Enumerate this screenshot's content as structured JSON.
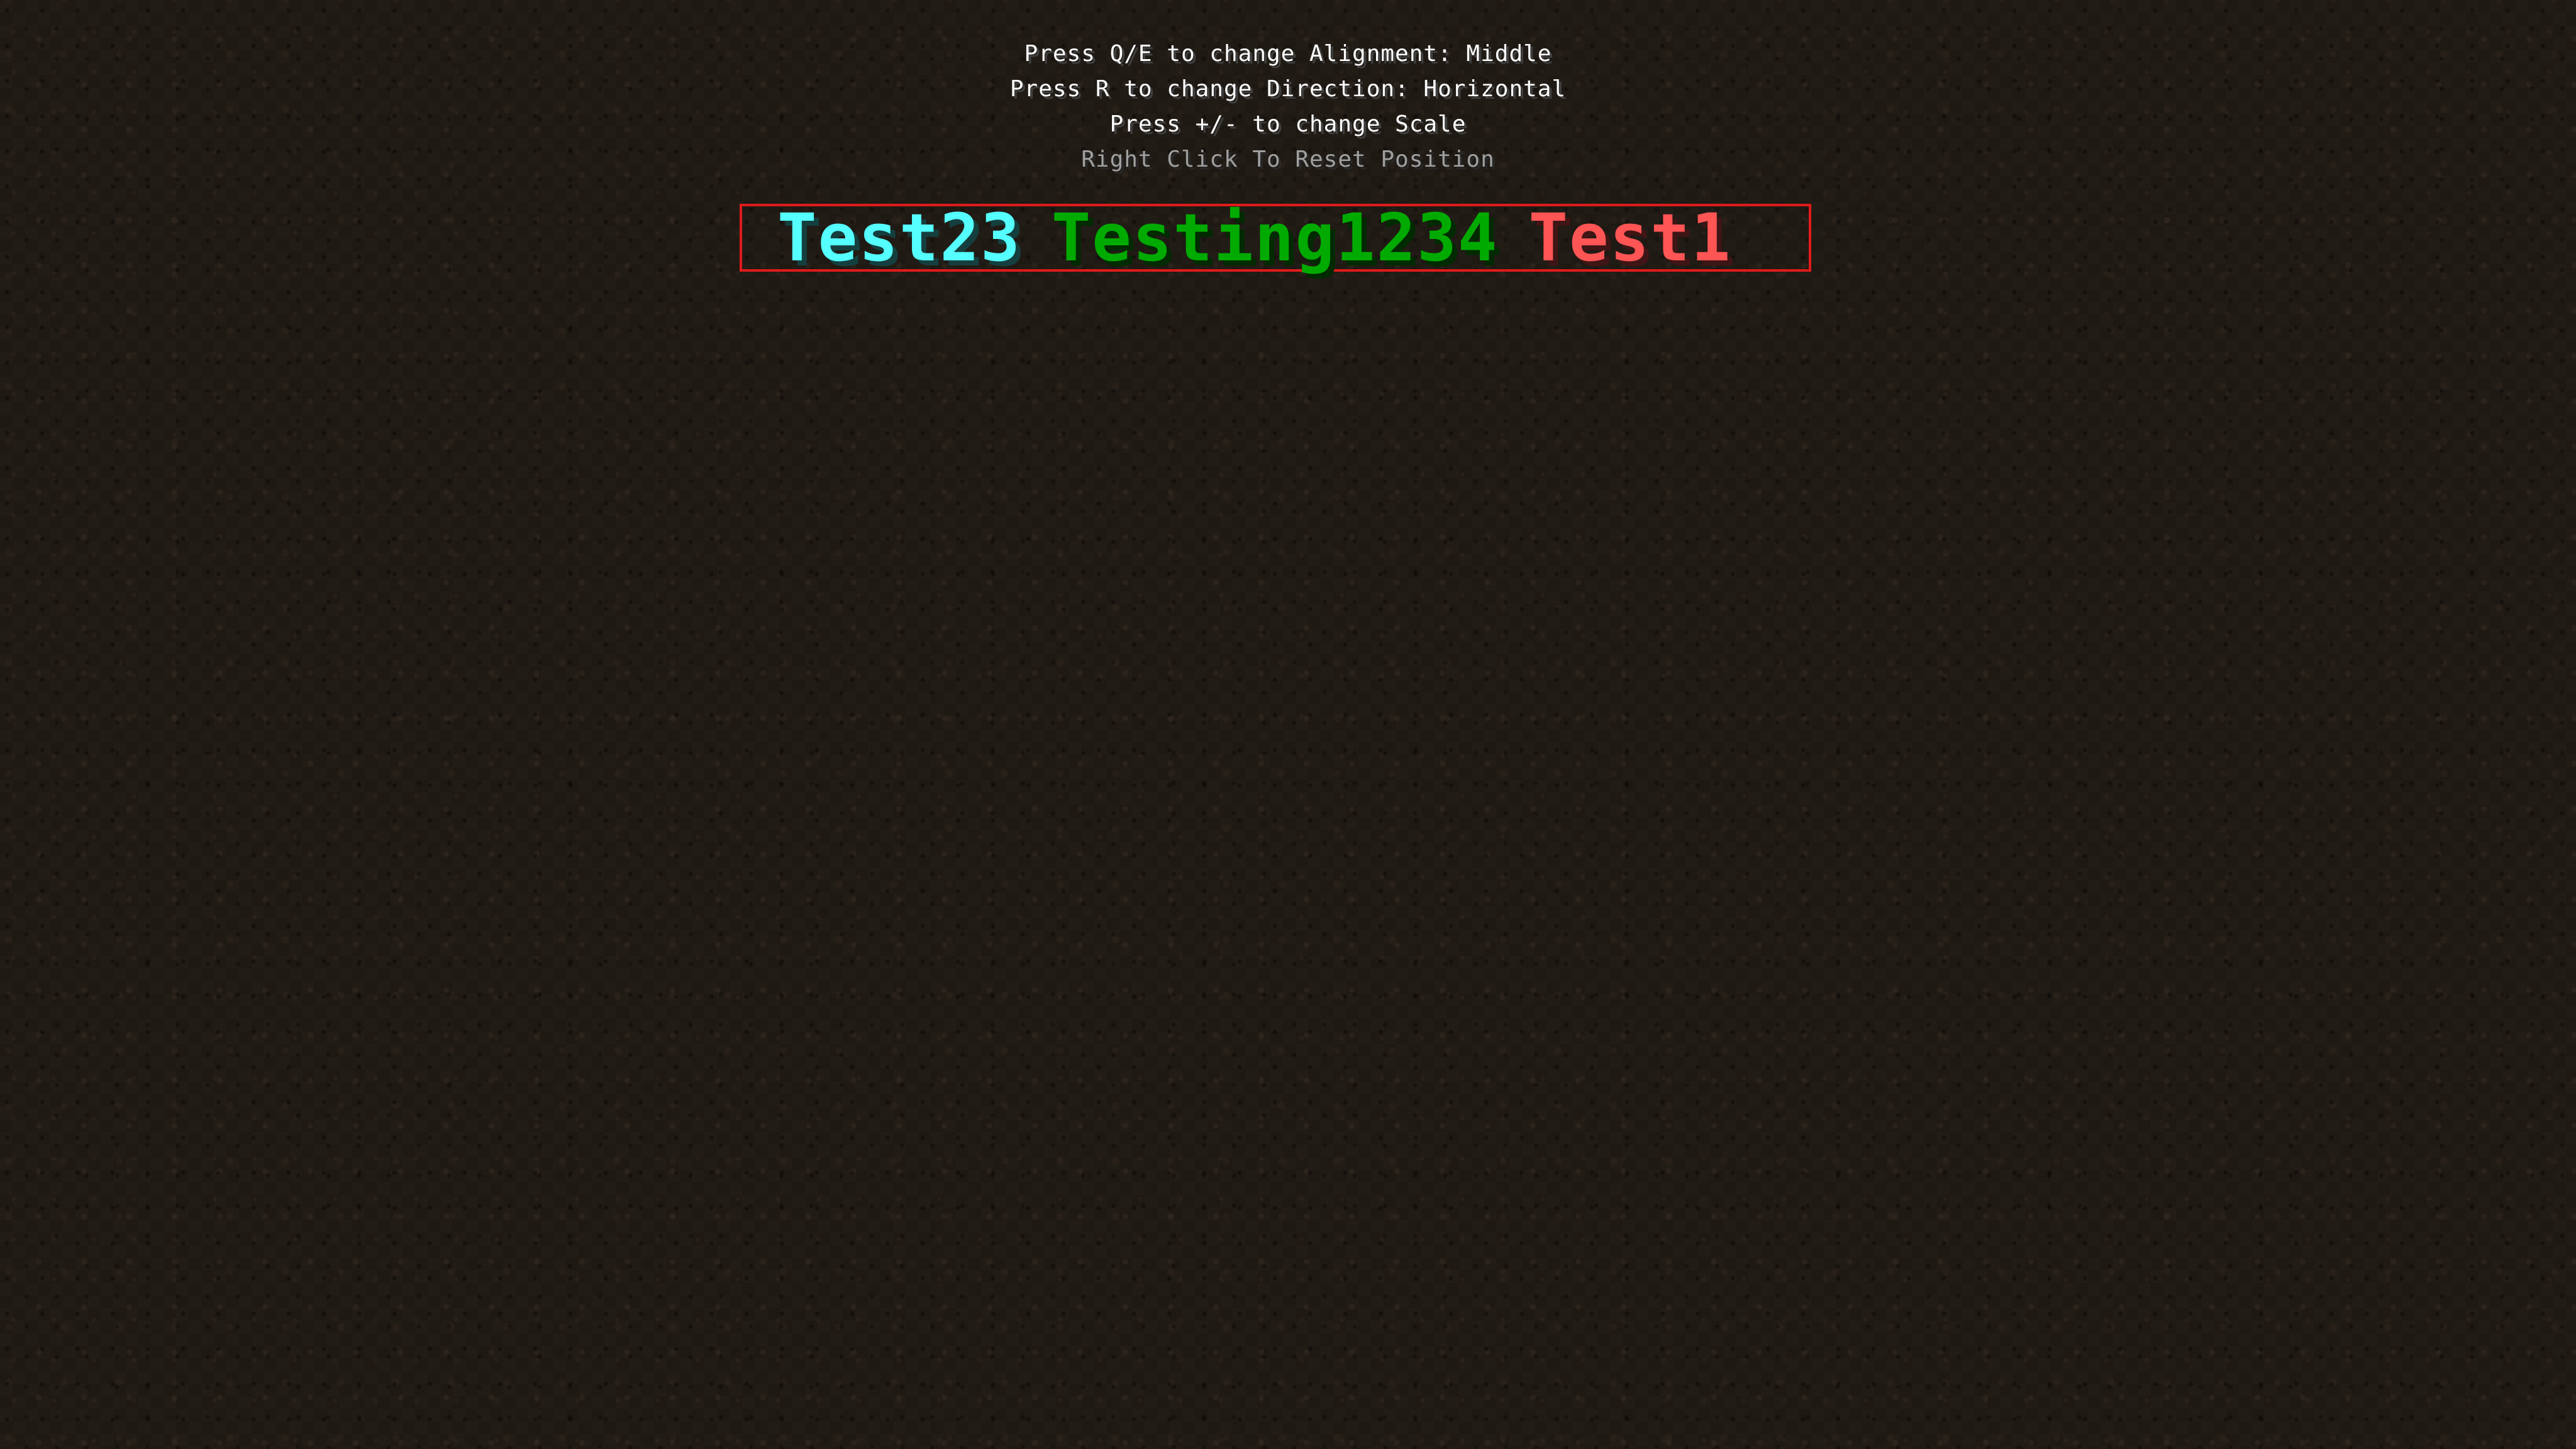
{
  "instructions": {
    "alignment": "Press Q/E to change Alignment: Middle",
    "direction": "Press R to change Direction: Horizontal",
    "scale": "Press +/- to change Scale",
    "reset": "Right Click To Reset Position"
  },
  "hud_entries": [
    {
      "text": "Test23",
      "color": "#55ffff",
      "shadow": "#153f3f"
    },
    {
      "text": "Testing1234",
      "color": "#00aa00",
      "shadow": "#002a00"
    },
    {
      "text": "Test1",
      "color": "#ff5555",
      "shadow": "#3f1515"
    }
  ],
  "colors": {
    "box_border": "#e01b1b",
    "instruction_text": "#ffffff",
    "instruction_dim": "#a0a0a0",
    "background": "#221c16"
  }
}
